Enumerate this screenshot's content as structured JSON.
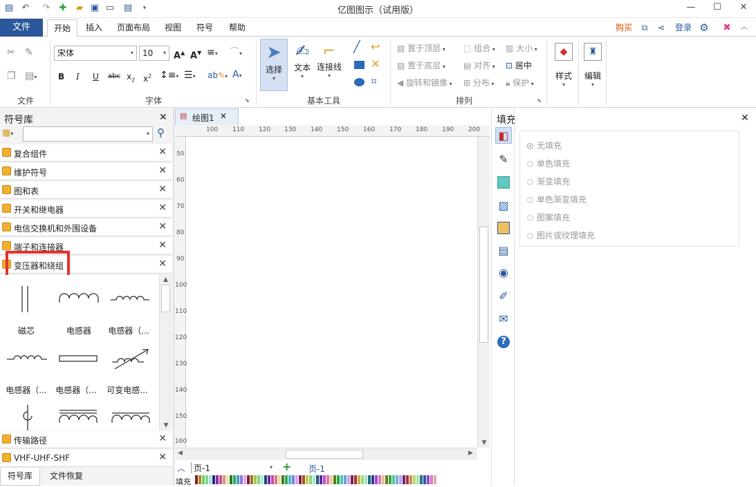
{
  "window": {
    "title": "亿图图示（试用版）",
    "minimize": "—",
    "maximize": "☐",
    "close": "✕"
  },
  "menu": {
    "file": "文件",
    "tabs": [
      "开始",
      "插入",
      "页面布局",
      "视图",
      "符号",
      "帮助"
    ],
    "right": {
      "buy": "购买",
      "login": "登录"
    }
  },
  "ribbon": {
    "groups": {
      "file": "文件",
      "font": "字体",
      "basic_tools": "基本工具",
      "arrange": "排列"
    },
    "font_name": "宋体",
    "font_size": "10",
    "tools": {
      "select": "选择",
      "text": "文本",
      "connector": "连接线"
    },
    "arrange": {
      "bring_front": "置于顶层",
      "send_back": "置于底层",
      "rotate_mirror": "旋转和镜像",
      "group": "组合",
      "align": "对齐",
      "distribute": "分布",
      "size": "大小",
      "center": "居中",
      "protect": "保护"
    },
    "style": "样式",
    "edit": "编辑"
  },
  "library": {
    "title": "符号库",
    "search_placeholder": "",
    "categories": [
      "复合组件",
      "维护符号",
      "图和表",
      "开关和继电器",
      "电信交换机和外围设备",
      "端子和连接器",
      "变压器和绕组"
    ],
    "symbols": [
      "磁芯",
      "电感器",
      "电感器（...",
      "电感器（...",
      "电感器（...",
      "可变电感..."
    ],
    "bottom_categories": [
      "传输路径",
      "VHF-UHF-SHF"
    ],
    "bottom_tabs": [
      "符号库",
      "文件恢复"
    ]
  },
  "canvas": {
    "tab": "绘图1",
    "h_ticks": [
      "100",
      "110",
      "120",
      "130",
      "140",
      "150",
      "160",
      "170",
      "180",
      "190",
      "200"
    ],
    "v_ticks": [
      "50",
      "60",
      "70",
      "80",
      "90",
      "100",
      "110",
      "120",
      "130",
      "140",
      "150",
      "160"
    ],
    "page_select": "页-1",
    "page_tab": "页-1",
    "fill_label": "填充"
  },
  "fill_panel": {
    "title": "填充",
    "options": [
      "无填充",
      "单色填充",
      "渐变填充",
      "单色渐变填充",
      "图案填充",
      "图片或纹理填充"
    ]
  },
  "colors": {
    "accent": "#2b579a",
    "highlight": "#e8302a",
    "buy": "#d94f00"
  }
}
